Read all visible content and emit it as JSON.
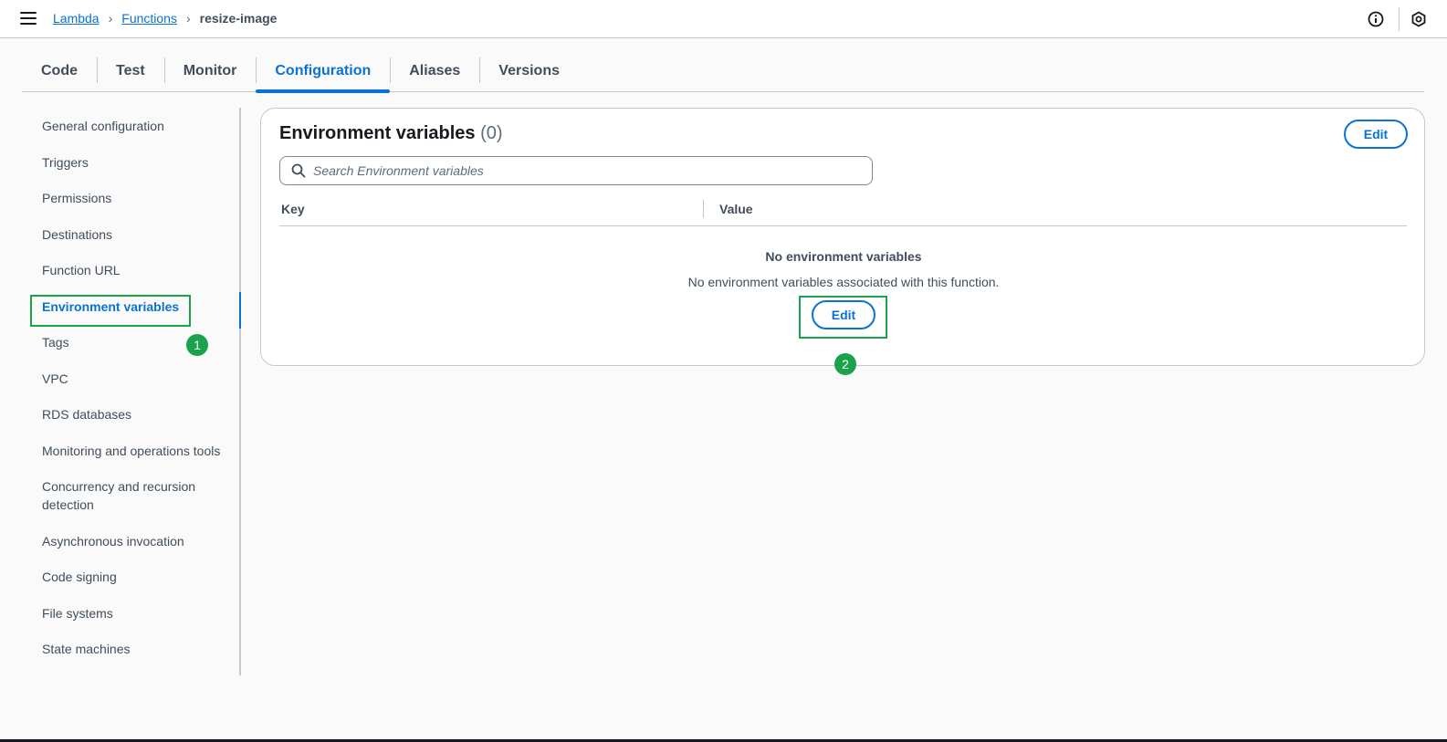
{
  "breadcrumb": {
    "items": [
      "Lambda",
      "Functions"
    ],
    "current": "resize-image"
  },
  "tabs": [
    "Code",
    "Test",
    "Monitor",
    "Configuration",
    "Aliases",
    "Versions"
  ],
  "active_tab": "Configuration",
  "sidebar": {
    "items": [
      "General configuration",
      "Triggers",
      "Permissions",
      "Destinations",
      "Function URL",
      "Environment variables",
      "Tags",
      "VPC",
      "RDS databases",
      "Monitoring and operations tools",
      "Concurrency and recursion detection",
      "Asynchronous invocation",
      "Code signing",
      "File systems",
      "State machines"
    ],
    "active": "Environment variables"
  },
  "panel": {
    "title": "Environment variables",
    "count": "(0)",
    "edit_label": "Edit",
    "search_placeholder": "Search Environment variables",
    "columns": [
      "Key",
      "Value"
    ],
    "empty_title": "No environment variables",
    "empty_desc": "No environment variables associated with this function.",
    "empty_edit_label": "Edit"
  },
  "annotations": {
    "step1": "1",
    "step2": "2",
    "color": "#1aa34a"
  },
  "colors": {
    "accent": "#0972d3",
    "text": "#16191f",
    "muted": "#414d5c"
  }
}
